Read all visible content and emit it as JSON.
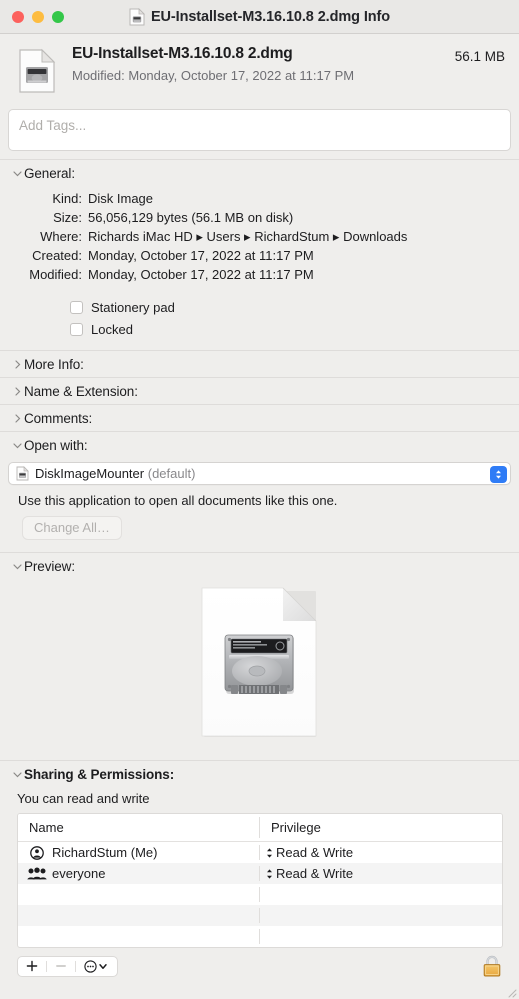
{
  "window": {
    "title": "EU-Installset-M3.16.10.8 2.dmg Info",
    "title_icon": "dmg-document-icon",
    "traffic_lights": {
      "close_label": "close",
      "minimize_label": "minimize",
      "zoom_label": "zoom",
      "close_color": "#fc615d",
      "minimize_color": "#fdbc40",
      "zoom_color": "#34c749"
    }
  },
  "header": {
    "icon": "dmg-document-icon",
    "file_name": "EU-Installset-M3.16.10.8 2.dmg",
    "modified_line": "Modified: Monday, October 17, 2022 at 11:17 PM",
    "size": "56.1 MB"
  },
  "tags": {
    "placeholder": "Add Tags...",
    "value": ""
  },
  "general": {
    "header": "General:",
    "expanded": true,
    "rows": [
      {
        "key": "Kind:",
        "value": "Disk Image"
      },
      {
        "key": "Size:",
        "value": "56,056,129 bytes (56.1 MB on disk)"
      },
      {
        "key": "Where:",
        "value": "Richards iMac HD ▸ Users ▸ RichardStum ▸ Downloads"
      },
      {
        "key": "Created:",
        "value": "Monday, October 17, 2022 at 11:17 PM"
      },
      {
        "key": "Modified:",
        "value": "Monday, October 17, 2022 at 11:17 PM"
      }
    ],
    "checkboxes": [
      {
        "label": "Stationery pad",
        "checked": false
      },
      {
        "label": "Locked",
        "checked": false
      }
    ]
  },
  "collapsed_sections": [
    {
      "header": "More Info:"
    },
    {
      "header": "Name & Extension:"
    },
    {
      "header": "Comments:"
    }
  ],
  "open_with": {
    "header": "Open with:",
    "expanded": true,
    "app_icon": "dmg-document-icon",
    "selected_app": "DiskImageMounter",
    "selected_app_suffix": "(default)",
    "note": "Use this application to open all documents like this one.",
    "change_all_label": "Change All…",
    "change_all_disabled": true,
    "accent_color": "#2f7cf6"
  },
  "preview": {
    "header": "Preview:",
    "expanded": true,
    "image_alt": "disk-image-document-thumbnail"
  },
  "sharing": {
    "header": "Sharing & Permissions:",
    "expanded": true,
    "note": "You can read and write",
    "columns": [
      "Name",
      "Privilege"
    ],
    "rows": [
      {
        "icon": "user-circle-icon",
        "name": "RichardStum (Me)",
        "privilege": "Read & Write"
      },
      {
        "icon": "group-people-icon",
        "name": "everyone",
        "privilege": "Read & Write"
      },
      {
        "icon": "",
        "name": "",
        "privilege": ""
      },
      {
        "icon": "",
        "name": "",
        "privilege": ""
      },
      {
        "icon": "",
        "name": "",
        "privilege": ""
      }
    ],
    "toolbar": {
      "add_label": "+",
      "remove_label": "−",
      "action_label": "action-menu",
      "remove_disabled": true
    },
    "lock": {
      "state": "locked",
      "name": "lock-closed-icon",
      "body_color": "#f0b551"
    }
  }
}
